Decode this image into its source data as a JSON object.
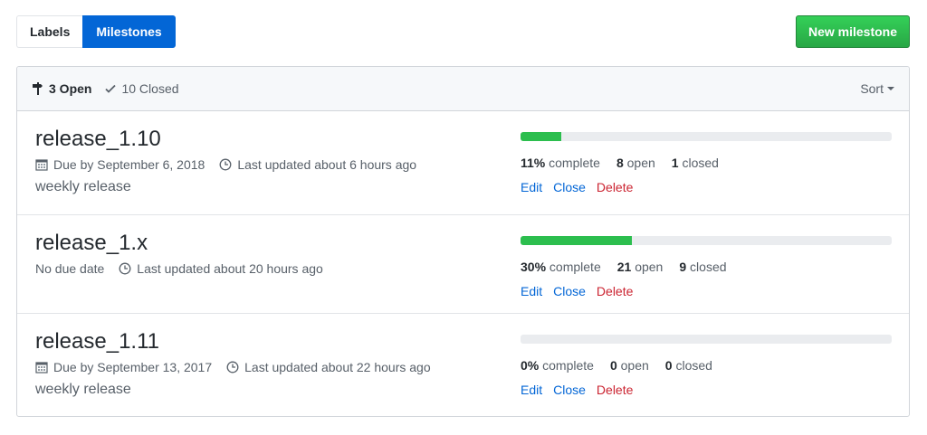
{
  "tabs": {
    "labels": "Labels",
    "milestones": "Milestones"
  },
  "new_button": "New milestone",
  "header": {
    "open_count": "3 Open",
    "closed_count": "10 Closed",
    "sort": "Sort"
  },
  "milestones": [
    {
      "title": "release_1.10",
      "due": "Due by September 6, 2018",
      "updated": "Last updated about 6 hours ago",
      "description": "weekly release",
      "percent": "11%",
      "percent_label": "complete",
      "progress": 0.11,
      "open": "8",
      "open_label": "open",
      "closed": "1",
      "closed_label": "closed",
      "edit": "Edit",
      "close": "Close",
      "delete": "Delete"
    },
    {
      "title": "release_1.x",
      "due": "No due date",
      "updated": "Last updated about 20 hours ago",
      "description": "",
      "percent": "30%",
      "percent_label": "complete",
      "progress": 0.3,
      "open": "21",
      "open_label": "open",
      "closed": "9",
      "closed_label": "closed",
      "edit": "Edit",
      "close": "Close",
      "delete": "Delete"
    },
    {
      "title": "release_1.11",
      "due": "Due by September 13, 2017",
      "updated": "Last updated about 22 hours ago",
      "description": "weekly release",
      "percent": "0%",
      "percent_label": "complete",
      "progress": 0.0,
      "open": "0",
      "open_label": "open",
      "closed": "0",
      "closed_label": "closed",
      "edit": "Edit",
      "close": "Close",
      "delete": "Delete"
    }
  ],
  "colors": {
    "accent": "#0366d6",
    "success": "#2cbe4e",
    "danger": "#cb2431"
  }
}
